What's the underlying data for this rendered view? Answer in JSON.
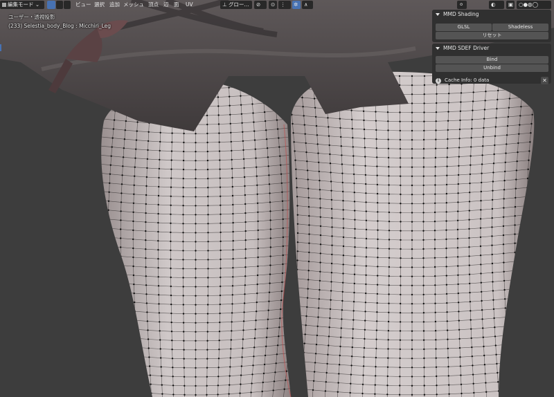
{
  "header": {
    "mode": "編集モード",
    "menus": [
      "ビュー",
      "選択",
      "追加",
      "メッシュ",
      "頂点",
      "辺",
      "面",
      "UV"
    ],
    "transform_orientation": "グロー..."
  },
  "overlay": {
    "view_name": "ユーザー・透視投影",
    "object_info": "(233) Selestia_body_Blog : Micchiri_Leg"
  },
  "panels": {
    "mmd_shading": {
      "title": "MMD Shading",
      "glsl": "GLSL",
      "shadeless": "Shadeless",
      "reset": "リセット"
    },
    "mmd_sdef": {
      "title": "MMD SDEF Driver",
      "bind": "Bind",
      "unbind": "Unbind",
      "cache_info": "Cache Info: 0 data"
    }
  },
  "colors": {
    "viewport_bg": "#3d3d3d",
    "header_bg": "#282828",
    "accent_blue": "#4772b3",
    "panel_bg": "#303030",
    "button_bg": "#545454",
    "mesh_skin": "#c9c2c2",
    "skirt": "#4a4546",
    "wire_vertex": "#101010"
  },
  "icons": [
    "mode-icon",
    "vertex-select-icon",
    "edge-select-icon",
    "face-select-icon",
    "orientation-icon",
    "link-icon",
    "pivot-icon",
    "snap-icon",
    "proportional-icon",
    "overlay-icon",
    "xray-icon",
    "shading-solid-icon",
    "shading-material-icon",
    "shading-rendered-icon",
    "info-icon",
    "close-icon"
  ]
}
